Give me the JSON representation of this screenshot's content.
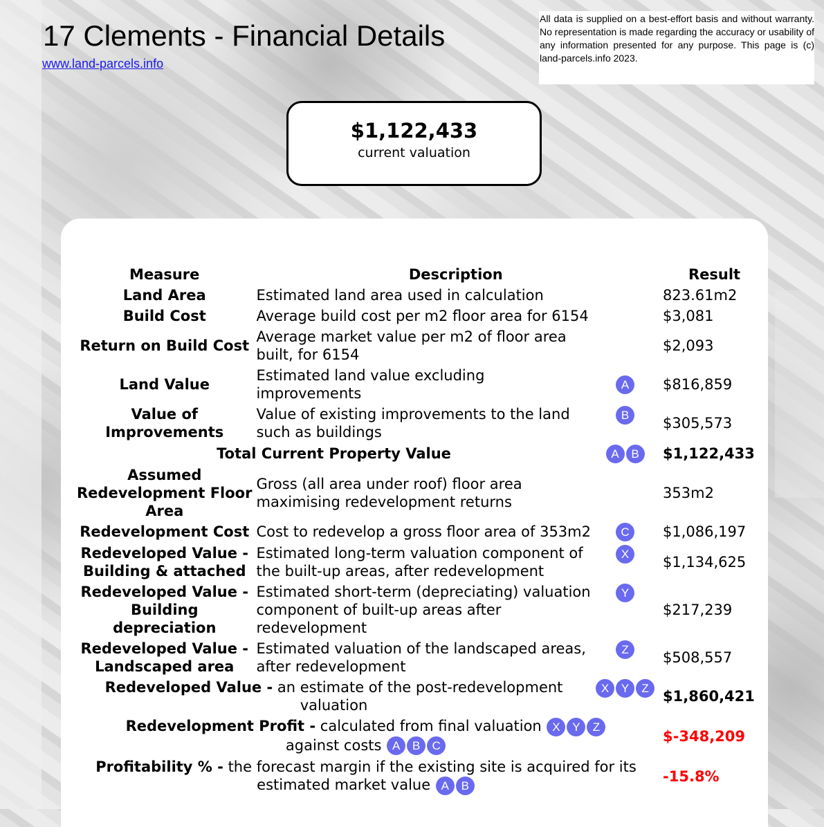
{
  "header": {
    "title": "17 Clements - Financial Details",
    "site_link": "www.land-parcels.info",
    "disclaimer": "All data is supplied on a best-effort basis and without warranty. No representation is made regarding the accuracy or usability of any information presented for any purpose. This page is (c) land-parcels.info 2023."
  },
  "valuation": {
    "amount": "$1,122,433",
    "label": "current valuation"
  },
  "table": {
    "columns": [
      "Measure",
      "Description",
      "Result"
    ],
    "rows": [
      {
        "measure": "Land Area",
        "description": "Estimated land area used in calculation",
        "badges": [],
        "result": "823.61m2"
      },
      {
        "measure": "Build Cost",
        "description": "Average build cost per m2 floor area for 6154",
        "badges": [],
        "result": "$3,081"
      },
      {
        "measure": "Return on Build Cost",
        "description": "Average market value per m2 of floor area built, for 6154",
        "badges": [],
        "result": "$2,093"
      },
      {
        "measure": "Land Value",
        "description": "Estimated land value excluding improvements",
        "badges": [
          "A"
        ],
        "result": "$816,859"
      },
      {
        "measure": "Value of Improvements",
        "description": "Value of existing improvements to the land such as buildings",
        "badges": [
          "B"
        ],
        "result": "$305,573"
      },
      {
        "measure": "Total Current Property Value",
        "description": "",
        "badges": [
          "A",
          "B"
        ],
        "result": "$1,122,433"
      },
      {
        "measure": "Assumed Redevelopment Floor Area",
        "description": "Gross (all area under roof) floor area maximising redevelopment returns",
        "badges": [],
        "result": "353m2"
      },
      {
        "measure": "Redevelopment Cost",
        "description": "Cost to redevelop a gross floor area of 353m2",
        "badges": [
          "C"
        ],
        "result": "$1,086,197"
      },
      {
        "measure": "Redeveloped Value - Building & attached",
        "description": "Estimated long-term valuation component of the built-up areas, after redevelopment",
        "badges": [
          "X"
        ],
        "result": "$1,134,625"
      },
      {
        "measure": "Redeveloped Value - Building depreciation",
        "description": "Estimated short-term (depreciating) valuation component of built-up areas after redevelopment",
        "badges": [
          "Y"
        ],
        "result": "$217,239"
      },
      {
        "measure": "Redeveloped Value - Landscaped area",
        "description": "Estimated valuation of the landscaped areas, after redevelopment",
        "badges": [
          "Z"
        ],
        "result": "$508,557"
      },
      {
        "measure": "Redeveloped Value -",
        "description": "an estimate of the post-redevelopment valuation",
        "badges": [
          "X",
          "Y",
          "Z"
        ],
        "result": "$1,860,421"
      },
      {
        "measure": "Redevelopment Profit -",
        "description": "calculated from final valuation",
        "badges": [
          "X",
          "Y",
          "Z"
        ],
        "description2": "against costs",
        "badges2": [
          "A",
          "B",
          "C"
        ],
        "result": "$-348,209"
      },
      {
        "measure": "Profitability % -",
        "description": "the forecast margin if the existing site is acquired for its estimated market value",
        "badges": [
          "A",
          "B"
        ],
        "result": "-15.8%"
      }
    ]
  },
  "colors": {
    "badge": "#6a6aef",
    "negative": "#ff0000",
    "link": "#1a1aee"
  }
}
